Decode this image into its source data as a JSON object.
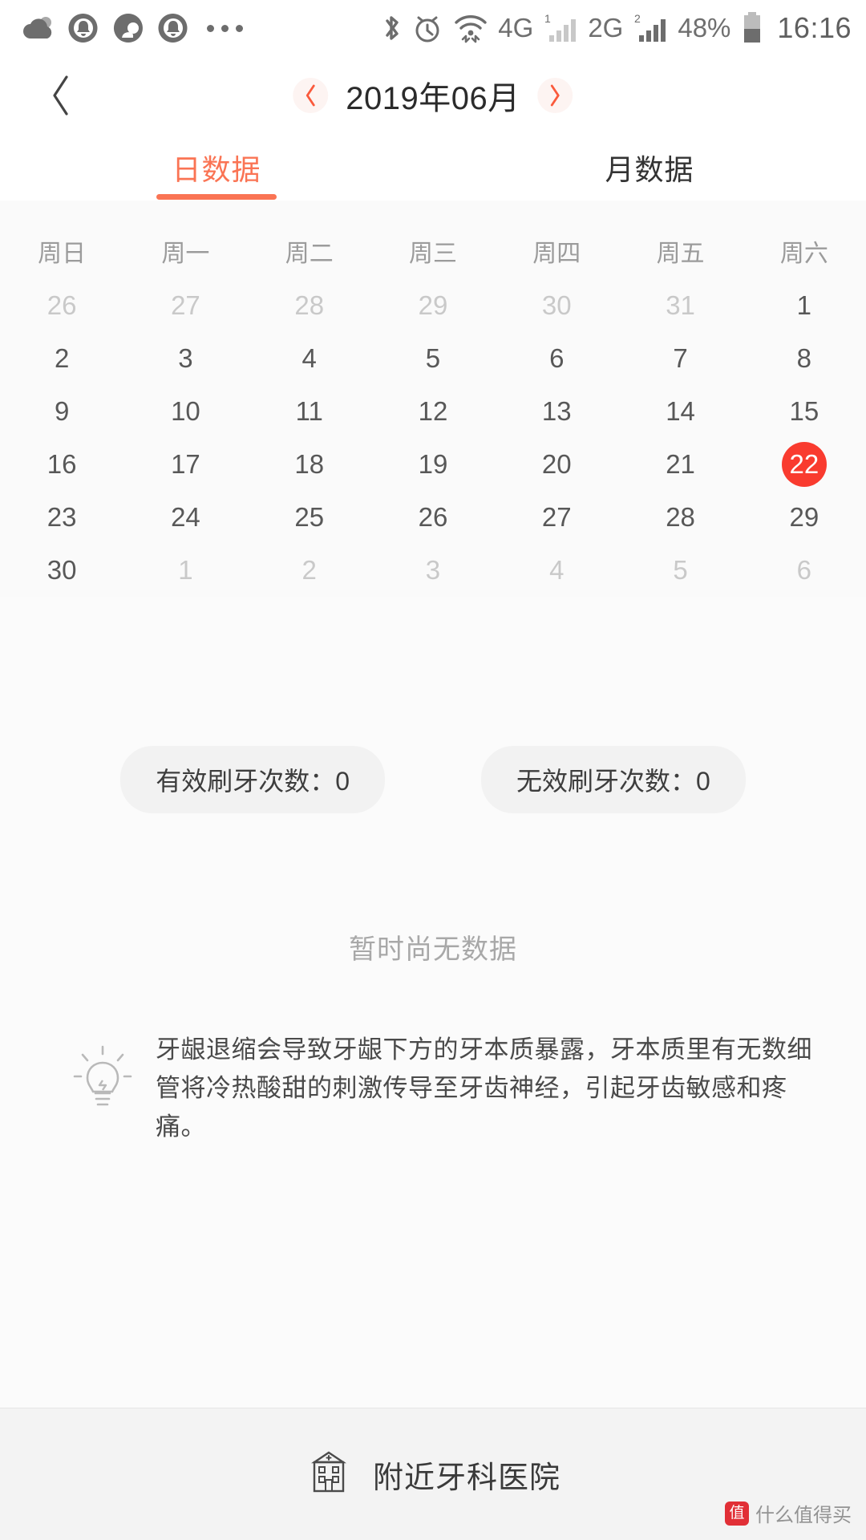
{
  "statusbar": {
    "icons_left": [
      "cloud-icon",
      "notification-ring-icon",
      "qq-icon",
      "notification-ring-icon",
      "more-dots-icon"
    ],
    "icons_right": [
      "bluetooth-icon",
      "alarm-icon",
      "wifi-icon"
    ],
    "network_4g": "4G",
    "network_2g": "2G",
    "sim1_label": "1",
    "sim2_label": "2",
    "battery_percent": "48%",
    "time": "16:16"
  },
  "header": {
    "back_label": "‹",
    "prev_label": "‹",
    "next_label": "›",
    "month_title": "2019年06月",
    "accent": "#fa5a3c"
  },
  "tabs": [
    {
      "label": "日数据",
      "active": true
    },
    {
      "label": "月数据",
      "active": false
    }
  ],
  "calendar": {
    "weekdays": [
      "周日",
      "周一",
      "周二",
      "周三",
      "周四",
      "周五",
      "周六"
    ],
    "selected_day": 22,
    "selected_color": "#f93b2f",
    "rows": [
      [
        {
          "n": "26",
          "cur": false
        },
        {
          "n": "27",
          "cur": false
        },
        {
          "n": "28",
          "cur": false
        },
        {
          "n": "29",
          "cur": false
        },
        {
          "n": "30",
          "cur": false
        },
        {
          "n": "31",
          "cur": false
        },
        {
          "n": "1",
          "cur": true
        }
      ],
      [
        {
          "n": "2",
          "cur": true
        },
        {
          "n": "3",
          "cur": true
        },
        {
          "n": "4",
          "cur": true
        },
        {
          "n": "5",
          "cur": true
        },
        {
          "n": "6",
          "cur": true
        },
        {
          "n": "7",
          "cur": true
        },
        {
          "n": "8",
          "cur": true
        }
      ],
      [
        {
          "n": "9",
          "cur": true
        },
        {
          "n": "10",
          "cur": true
        },
        {
          "n": "11",
          "cur": true
        },
        {
          "n": "12",
          "cur": true
        },
        {
          "n": "13",
          "cur": true
        },
        {
          "n": "14",
          "cur": true
        },
        {
          "n": "15",
          "cur": true
        }
      ],
      [
        {
          "n": "16",
          "cur": true
        },
        {
          "n": "17",
          "cur": true
        },
        {
          "n": "18",
          "cur": true
        },
        {
          "n": "19",
          "cur": true
        },
        {
          "n": "20",
          "cur": true
        },
        {
          "n": "21",
          "cur": true
        },
        {
          "n": "22",
          "cur": true,
          "sel": true
        }
      ],
      [
        {
          "n": "23",
          "cur": true
        },
        {
          "n": "24",
          "cur": true
        },
        {
          "n": "25",
          "cur": true
        },
        {
          "n": "26",
          "cur": true
        },
        {
          "n": "27",
          "cur": true
        },
        {
          "n": "28",
          "cur": true
        },
        {
          "n": "29",
          "cur": true
        }
      ],
      [
        {
          "n": "30",
          "cur": true
        },
        {
          "n": "1",
          "cur": false
        },
        {
          "n": "2",
          "cur": false
        },
        {
          "n": "3",
          "cur": false
        },
        {
          "n": "4",
          "cur": false
        },
        {
          "n": "5",
          "cur": false
        },
        {
          "n": "6",
          "cur": false
        }
      ]
    ]
  },
  "stats": {
    "valid_label": "有效刷牙次数：0",
    "invalid_label": "无效刷牙次数：0"
  },
  "empty_state": {
    "text": "暂时尚无数据"
  },
  "tip": {
    "icon": "lightbulb-icon",
    "text": "牙龈退缩会导致牙龈下方的牙本质暴露，牙本质里有无数细管将冷热酸甜的刺激传导至牙齿神经，引起牙齿敏感和疼痛。"
  },
  "bottombar": {
    "icon": "hospital-icon",
    "label": "附近牙科医院"
  },
  "watermark": {
    "badge": "值",
    "text": "什么值得买"
  }
}
